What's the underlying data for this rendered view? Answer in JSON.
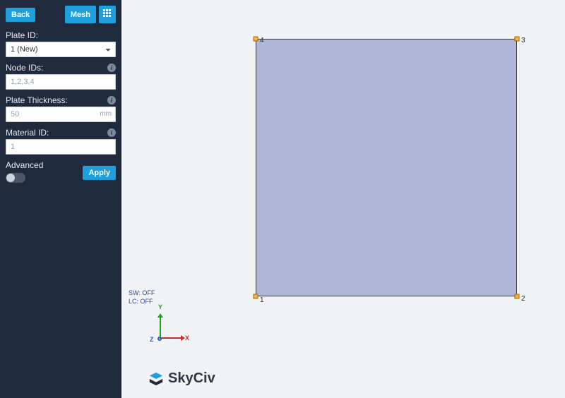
{
  "sidebar": {
    "back_label": "Back",
    "mesh_label": "Mesh",
    "fields": {
      "plate_id": {
        "label": "Plate ID:",
        "value": "1 (New)"
      },
      "node_ids": {
        "label": "Node IDs:",
        "placeholder": "1,2,3,4",
        "value": ""
      },
      "thickness": {
        "label": "Plate Thickness:",
        "placeholder": "50",
        "unit": "mm",
        "value": ""
      },
      "material": {
        "label": "Material ID:",
        "placeholder": "1",
        "value": ""
      }
    },
    "advanced_label": "Advanced",
    "apply_label": "Apply"
  },
  "canvas": {
    "nodes": {
      "n1": "1",
      "n2": "2",
      "n3": "3",
      "n4": "4"
    },
    "status": {
      "sw": "SW: OFF",
      "lc": "LC: OFF"
    },
    "axes": {
      "x": "X",
      "y": "Y",
      "z": "Z"
    }
  },
  "brand": {
    "name": "SkyCiv"
  }
}
